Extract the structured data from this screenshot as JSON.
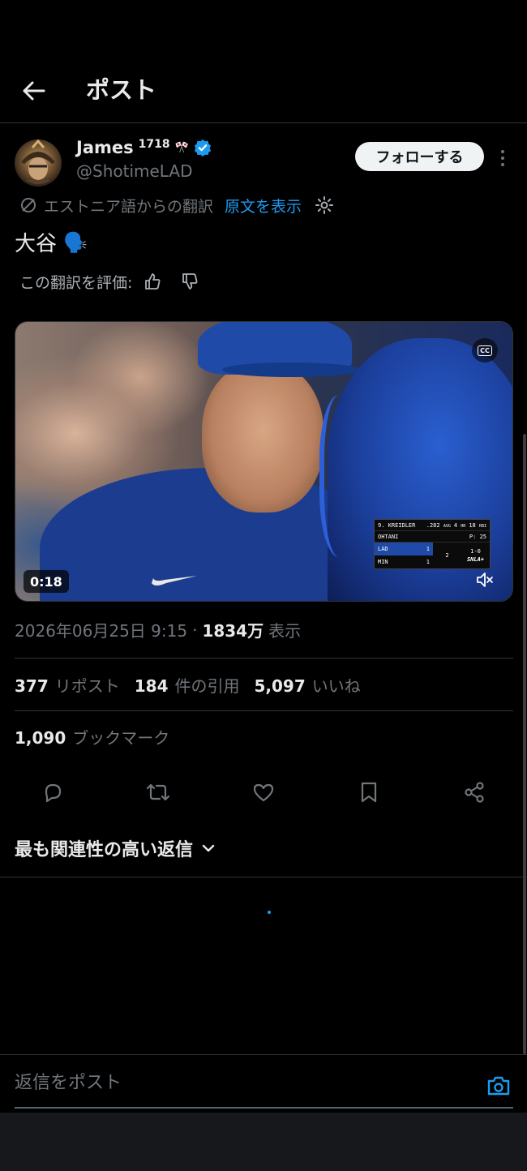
{
  "header": {
    "title": "ポスト"
  },
  "author": {
    "display_name": "James",
    "name_superscript": "1718",
    "name_emoji": "🎌",
    "handle": "@ShotimeLAD",
    "follow_label": "フォローする",
    "verified_color": "#1d9bf0"
  },
  "translation": {
    "source_label": "エストニア語からの翻訳",
    "show_original_label": "原文を表示",
    "rate_label": "この翻訳を評価:"
  },
  "post": {
    "text": "大谷",
    "emoji": "🗣️"
  },
  "media": {
    "duration": "0:18",
    "cc_label": "CC",
    "scorebug": {
      "batter": "9. KREIDLER",
      "avg": ".282",
      "avg_label": "AVG",
      "hr": "4",
      "hr_label": "HR",
      "rbi": "18",
      "rbi_label": "RBI",
      "pitcher": "OHTANI",
      "pitch_count": "P: 25",
      "team1": "LAD",
      "team1_score": "1",
      "team2": "MIN",
      "team2_score": "1",
      "inning": "2",
      "count": "1-0",
      "network": "SNLA+"
    }
  },
  "meta": {
    "timestamp": "2026年06月25日 9:15",
    "separator": "·",
    "views": "1834万",
    "views_label": "表示"
  },
  "stats": {
    "reposts": "377",
    "reposts_label": "リポスト",
    "quotes": "184",
    "quotes_label": "件の引用",
    "likes": "5,097",
    "likes_label": "いいね",
    "bookmarks": "1,090",
    "bookmarks_label": "ブックマーク"
  },
  "actions": [
    "reply-icon",
    "repost-icon",
    "like-icon",
    "bookmark-icon",
    "share-icon"
  ],
  "replies": {
    "sort_label": "最も関連性の高い返信"
  },
  "reply_bar": {
    "placeholder": "返信をポスト"
  },
  "colors": {
    "accent": "#1d9bf0",
    "background": "#000000",
    "muted": "#71767b"
  }
}
